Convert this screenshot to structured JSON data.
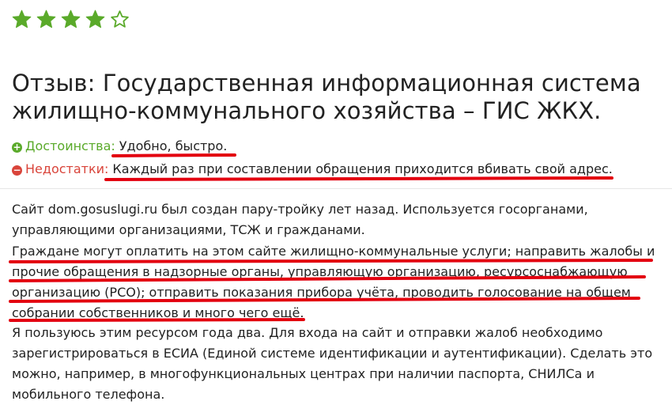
{
  "rating": {
    "value": 4,
    "max": 5,
    "filled_color": "#5aaa2a",
    "empty_color": "#5aaa2a",
    "icon": "star-icon"
  },
  "review": {
    "title": "Отзыв: Государственная информационная система жилищно-коммунального хозяйства – ГИС ЖКХ.",
    "pros": {
      "icon": "plus-circle-icon",
      "label": "Достоинства:",
      "value": "Удобно, быстро."
    },
    "cons": {
      "icon": "minus-circle-icon",
      "label": "Недостатки:",
      "value": "Каждый раз при составлении обращения приходится вбивать свой адрес."
    },
    "paragraphs": [
      "Сайт dom.gosuslugi.ru был создан пару-тройку лет назад. Используется госорганами, управляющими организациями, ТСЖ и гражданами.",
      "Граждане могут оплатить на этом сайте жилищно-коммунальные услуги; направить жалобы и прочие обращения в надзорные органы, управляющую организацию, ресурсоснабжающую организацию (РСО); отправить показания прибора учёта, проводить голосование на общем собрании собственников и много чего ещё.",
      "Я пользуюсь этим ресурсом года два. Для входа на сайт и отправки жалоб необходимо зарегистрироваться в ЕСИА (Единой системе идентификации и аутентификации). Сделать это можно, например, в многофункциональных центрах при наличии паспорта, СНИЛСа и мобильного телефона."
    ]
  },
  "colors": {
    "pros": "#5aaa2a",
    "cons": "#d9443a",
    "text": "#222222",
    "annotation": "#e3000f"
  }
}
